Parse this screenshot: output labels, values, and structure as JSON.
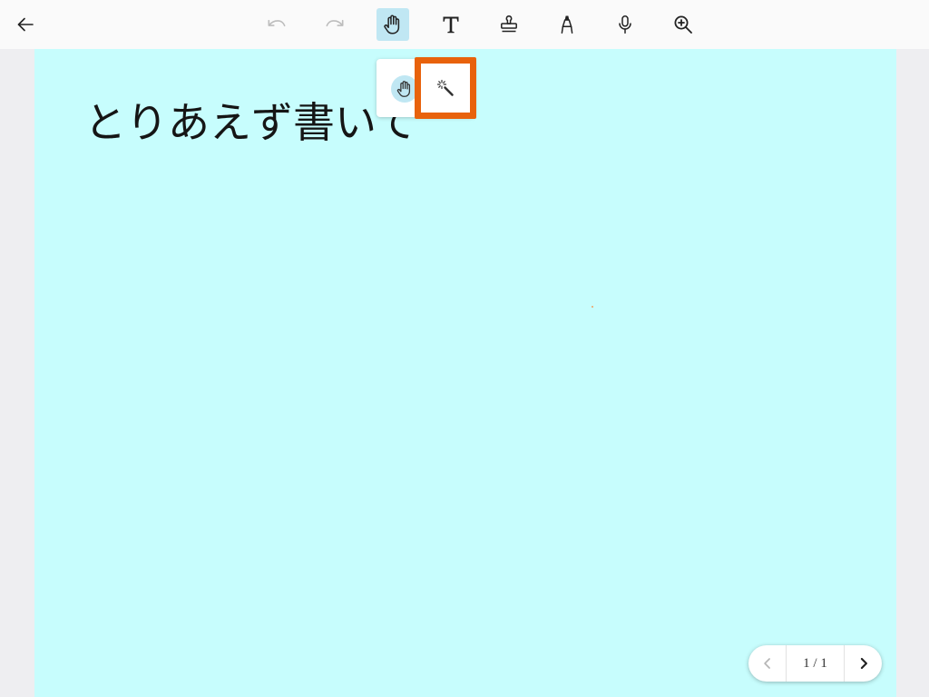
{
  "colors": {
    "toolbar_background": "#fafafa",
    "workspace_background": "#eeeef1",
    "page_background": "#c7fdfd",
    "selected_background": "#c0e7f3",
    "icon": "#222222",
    "disabled_icon": "#bdbdbd",
    "highlight_border": "#e8620c"
  },
  "toolbar": {
    "back_icon": "arrow-left-icon",
    "tools": [
      {
        "icon": "undo-icon",
        "disabled": true
      },
      {
        "icon": "redo-icon",
        "disabled": true
      },
      {
        "icon": "hand-icon",
        "selected": true
      },
      {
        "icon": "text-tool-icon"
      },
      {
        "icon": "stamp-icon"
      },
      {
        "icon": "marker-pen-icon"
      },
      {
        "icon": "microphone-icon"
      },
      {
        "icon": "zoom-in-icon"
      }
    ]
  },
  "hand_submenu": {
    "items": [
      {
        "icon": "hand-icon",
        "selected": true
      },
      {
        "icon": "magic-wand-icon",
        "selected": false,
        "highlighted": true
      }
    ]
  },
  "page": {
    "text": "とりあえず書いて"
  },
  "pager": {
    "indicator": "1 / 1",
    "prev_enabled": false,
    "next_enabled": true
  }
}
